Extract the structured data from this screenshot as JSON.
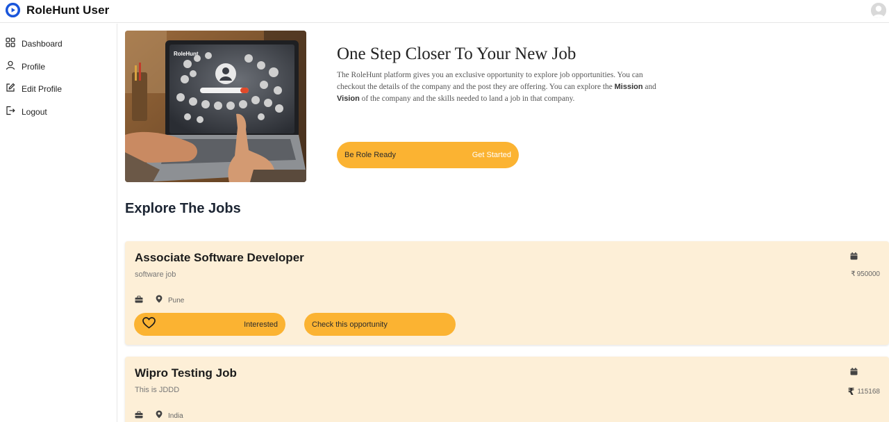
{
  "app": {
    "title": "RoleHunt User"
  },
  "sidebar": {
    "items": [
      {
        "label": "Dashboard",
        "icon": "dashboard-icon"
      },
      {
        "label": "Profile",
        "icon": "user-icon"
      },
      {
        "label": "Edit Profile",
        "icon": "edit-icon"
      },
      {
        "label": "Logout",
        "icon": "logout-icon"
      }
    ]
  },
  "hero": {
    "title": "One Step Closer To Your New Job",
    "text_1": "The RoleHunt platform gives you an exclusive opportunity to explore job opportunities. You can checkout the details of the company and the post they are offering. You can explore the ",
    "mission": "Mission",
    "text_and": " and ",
    "vision": "Vision",
    "text_2": " of the company and the skills needed to land a job in that company.",
    "cta_left": "Be Role Ready",
    "cta_right": "Get Started",
    "image_brand": "RoleHunt"
  },
  "section": {
    "title": "Explore The Jobs"
  },
  "jobs": [
    {
      "title": "Associate Software Developer",
      "subtitle": "software job",
      "location": "Pune",
      "currency": "₹",
      "salary": "950000",
      "interested_label": "Interested",
      "check_label": "Check this opportunity"
    },
    {
      "title": "Wipro Testing Job",
      "subtitle": "This is JDDD",
      "location": "India",
      "currency": "₹",
      "salary": "115168"
    }
  ],
  "colors": {
    "accent": "#fbb332",
    "card_bg": "#fdefd7",
    "brand": "#1a56db"
  }
}
